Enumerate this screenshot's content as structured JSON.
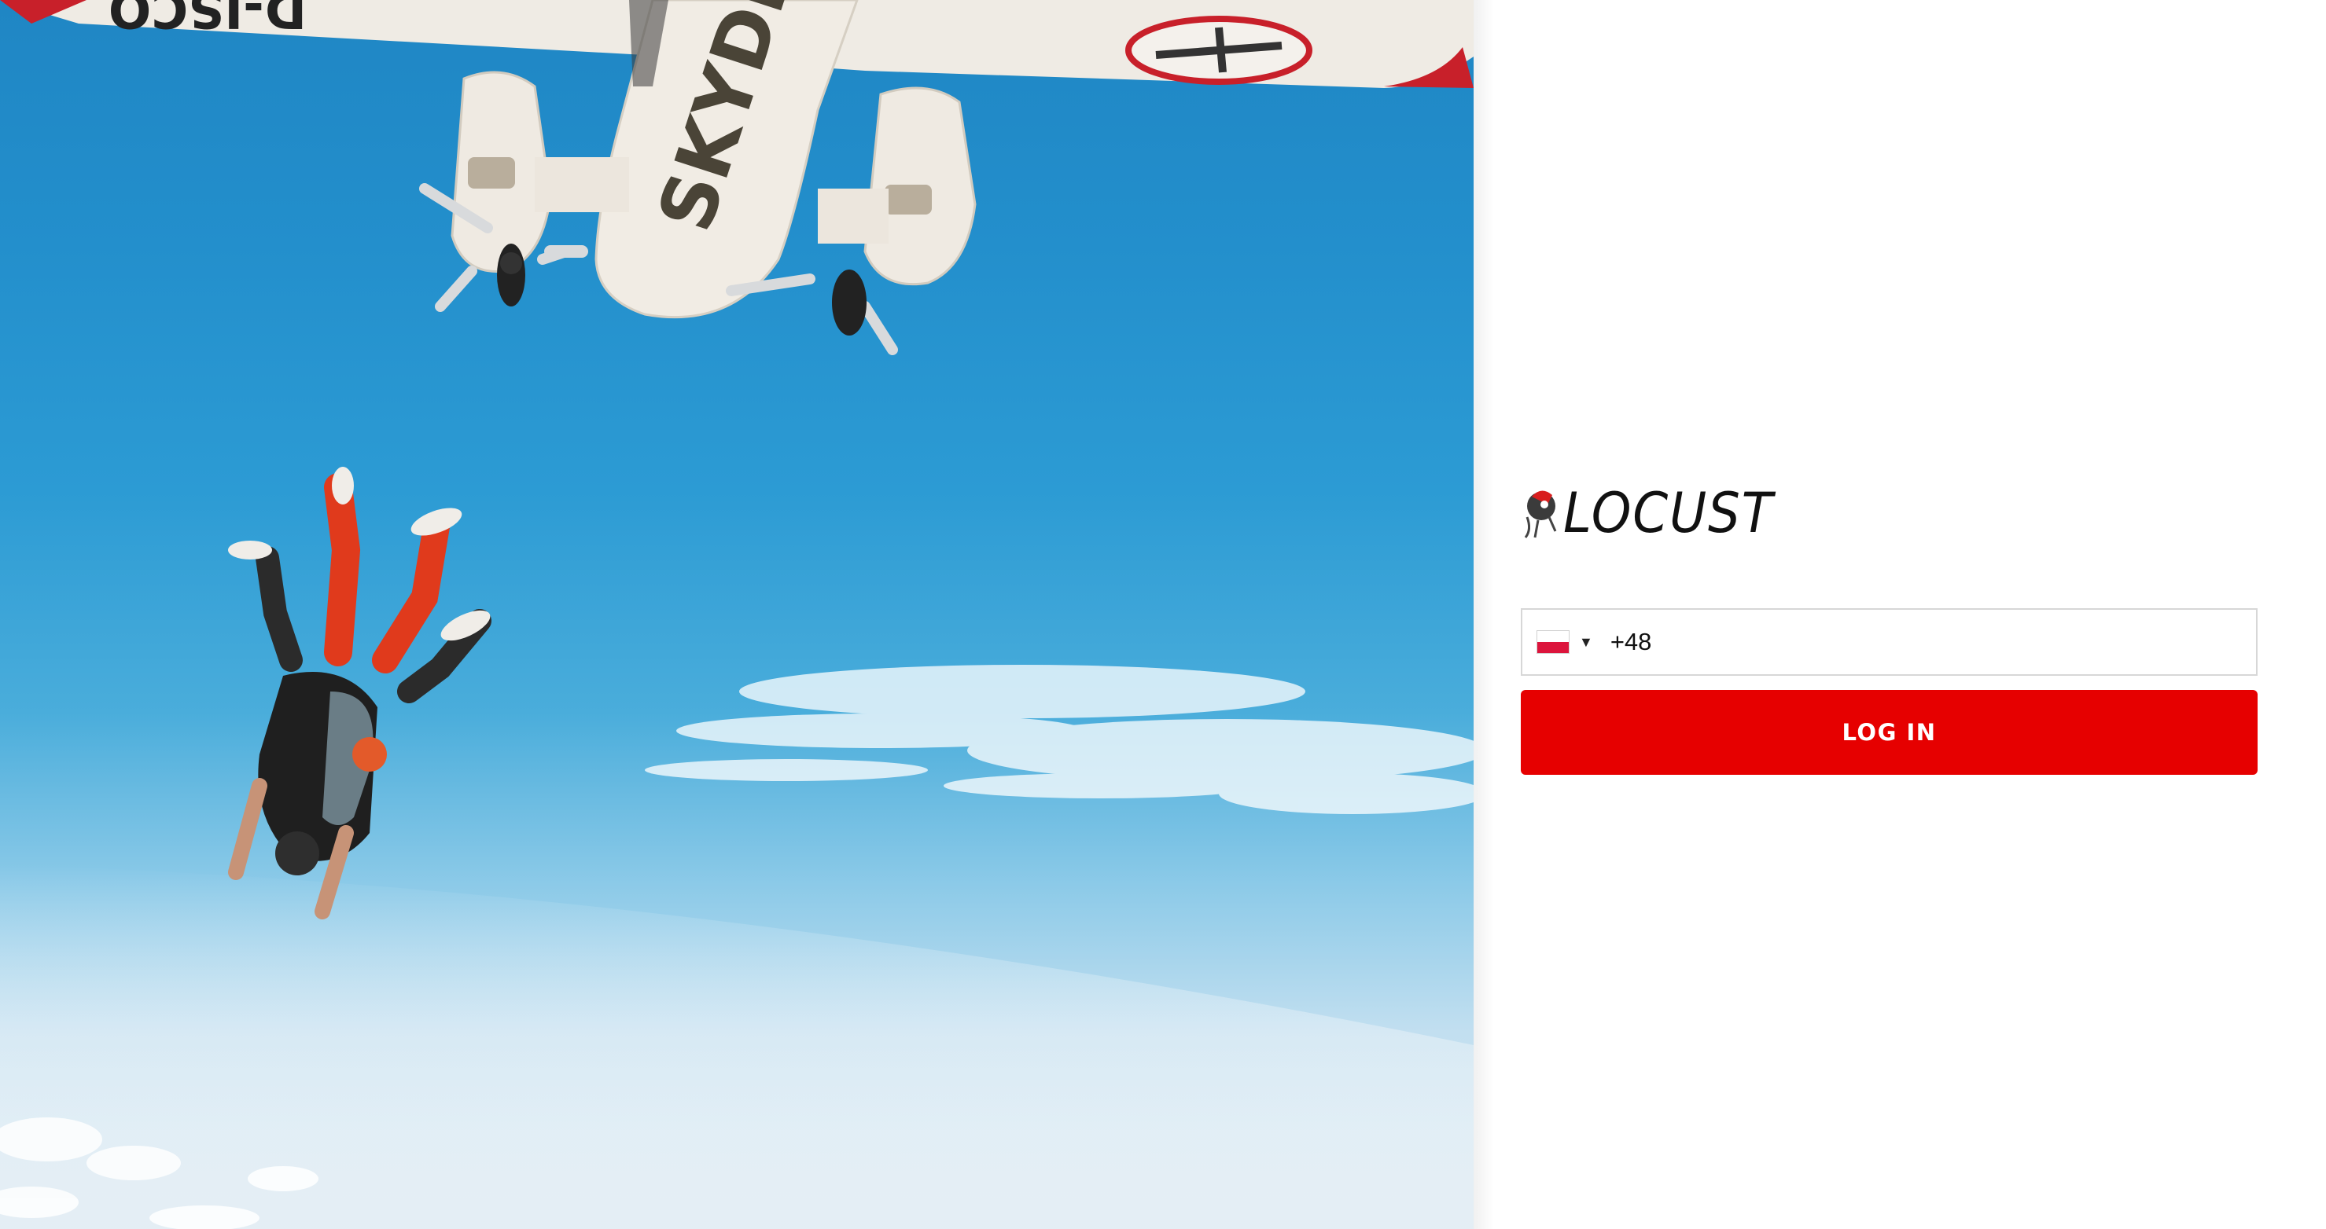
{
  "app": {
    "brand_name": "LOCUST",
    "colors": {
      "accent": "#e60000",
      "background": "#ffffff",
      "text": "#111111",
      "border": "#d7d7d7"
    }
  },
  "hero_image": {
    "plane_text": "SKYDIVE",
    "registration": "D-ISCO"
  },
  "login_form": {
    "country": {
      "flag_icon": "poland-flag-icon",
      "caret_icon": "triangle-down-icon"
    },
    "phone_value": "+48",
    "submit_label": "LOG IN"
  }
}
